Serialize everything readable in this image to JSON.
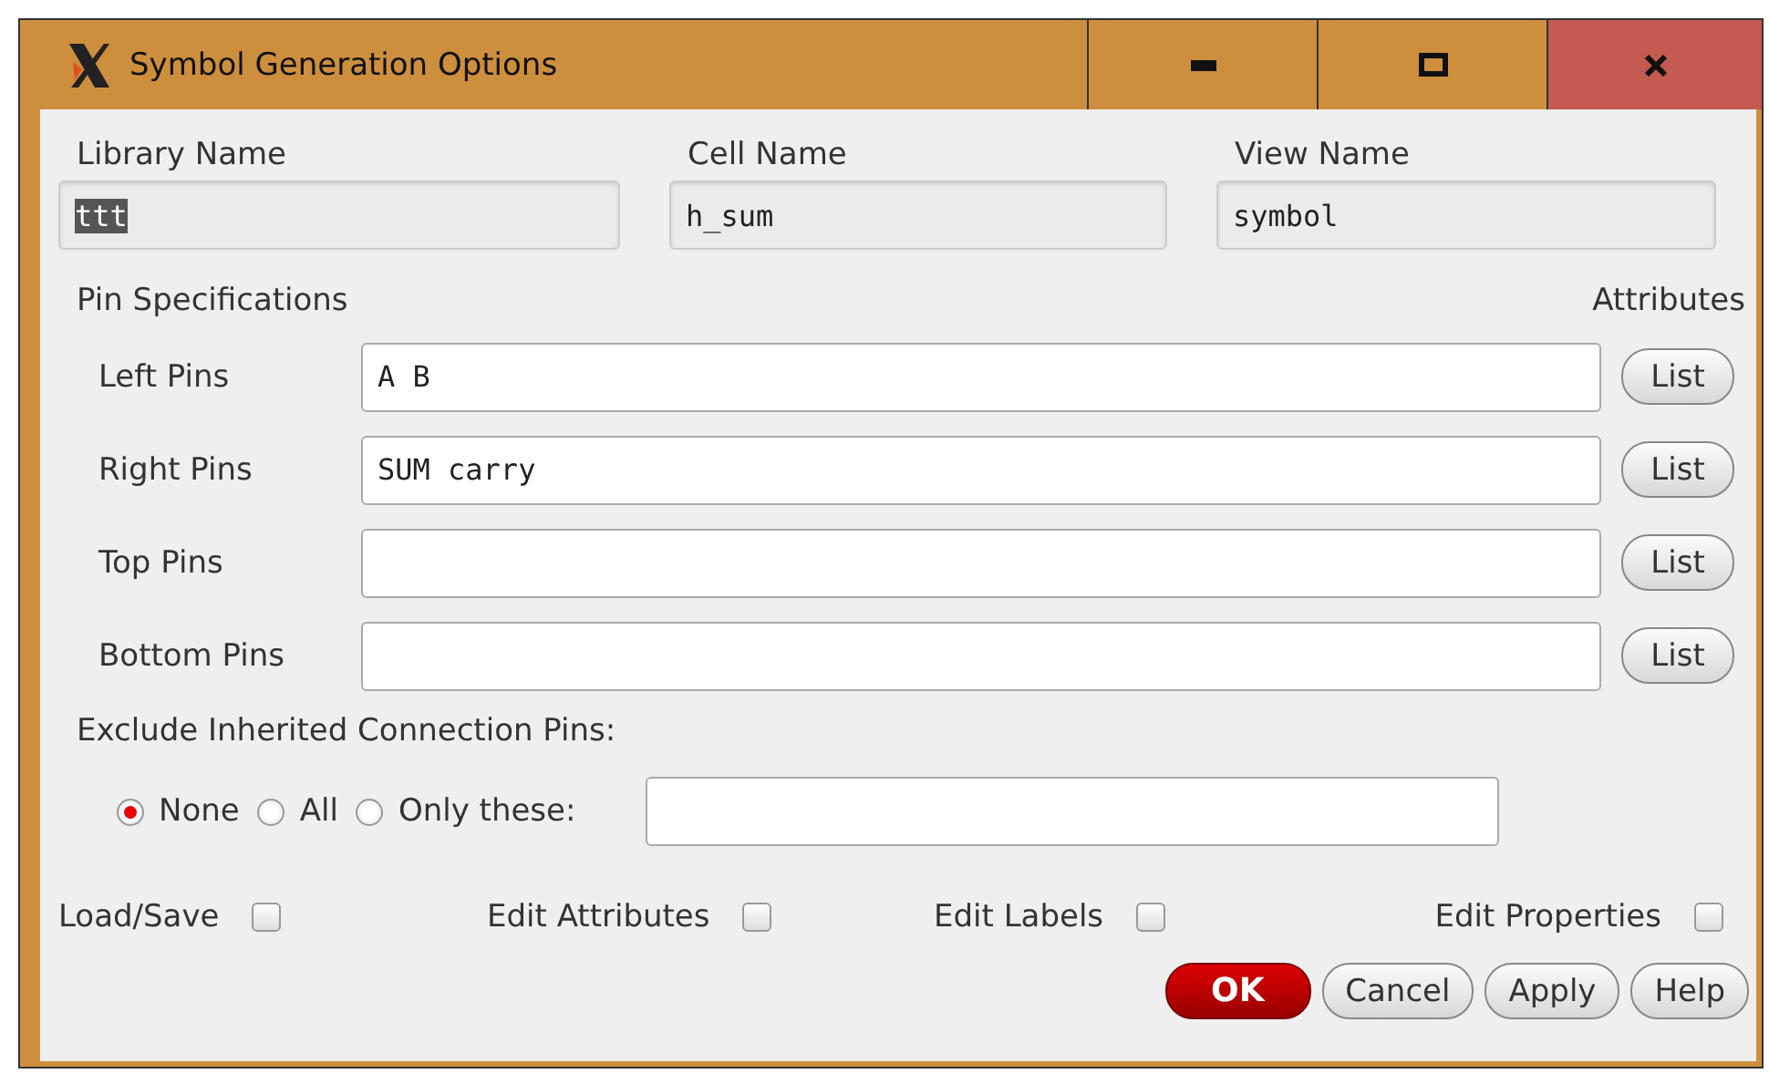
{
  "window": {
    "title": "Symbol Generation Options",
    "controls": [
      {
        "kind": "minimize"
      },
      {
        "kind": "maximize"
      },
      {
        "kind": "close"
      }
    ]
  },
  "names": [
    {
      "label": "Library Name",
      "value": "ttt",
      "highlighted": true
    },
    {
      "label": "Cell Name",
      "value": "h_sum",
      "highlighted": false
    },
    {
      "label": "View Name",
      "value": "symbol",
      "highlighted": false
    }
  ],
  "pin_specifications": {
    "title": "Pin Specifications",
    "attributes_label": "Attributes",
    "rows": [
      {
        "label": "Left Pins",
        "value": "A B",
        "button": "List"
      },
      {
        "label": "Right Pins",
        "value": "SUM carry",
        "button": "List"
      },
      {
        "label": "Top Pins",
        "button": "List"
      },
      {
        "label": "Bottom Pins",
        "button": "List"
      }
    ]
  },
  "exclude": {
    "label": "Exclude Inherited Connection Pins:",
    "options": [
      {
        "label": "None",
        "selected": true
      },
      {
        "label": "All",
        "selected": false
      },
      {
        "label": "Only these:",
        "selected": false
      }
    ]
  },
  "checkboxes": [
    {
      "label": "Load/Save",
      "checked": false
    },
    {
      "label": "Edit Attributes",
      "checked": false
    },
    {
      "label": "Edit Labels",
      "checked": false
    },
    {
      "label": "Edit Properties",
      "checked": false
    }
  ],
  "buttons": [
    {
      "label": "OK",
      "kind": "default"
    },
    {
      "label": "Cancel",
      "kind": "normal"
    },
    {
      "label": "Apply",
      "kind": "normal"
    },
    {
      "label": "Help",
      "kind": "normal"
    }
  ]
}
